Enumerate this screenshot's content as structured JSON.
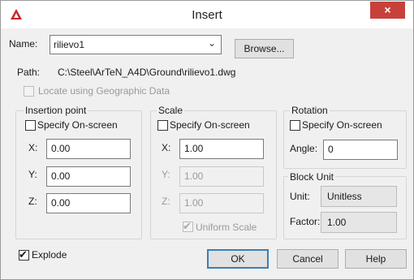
{
  "window": {
    "title": "Insert",
    "close_glyph": "×",
    "accent": "#c7413b"
  },
  "name_row": {
    "label": "Name:",
    "value": "rilievo1",
    "browse_label": "Browse..."
  },
  "path_row": {
    "label": "Path:",
    "value": "C:\\Steel\\ArTeN_A4D\\Ground\\rilievo1.dwg"
  },
  "geo": {
    "label": "Locate using Geographic Data",
    "checked": false
  },
  "insertion": {
    "title": "Insertion point",
    "specify_label": "Specify On-screen",
    "x_label": "X:",
    "x_value": "0.00",
    "y_label": "Y:",
    "y_value": "0.00",
    "z_label": "Z:",
    "z_value": "0.00"
  },
  "scale": {
    "title": "Scale",
    "specify_label": "Specify On-screen",
    "x_label": "X:",
    "x_value": "1.00",
    "y_label": "Y:",
    "y_value": "1.00",
    "z_label": "Z:",
    "z_value": "1.00",
    "uniform_label": "Uniform Scale",
    "uniform_checked": true
  },
  "rotation": {
    "title": "Rotation",
    "specify_label": "Specify On-screen",
    "angle_label": "Angle:",
    "angle_value": "0"
  },
  "block_unit": {
    "title": "Block Unit",
    "unit_label": "Unit:",
    "unit_value": "Unitless",
    "factor_label": "Factor:",
    "factor_value": "1.00"
  },
  "explode": {
    "label": "Explode",
    "checked": true
  },
  "buttons": {
    "ok": "OK",
    "cancel": "Cancel",
    "help": "Help"
  },
  "icons": {
    "app": "autocad-logo-icon",
    "dropdown": "chevron-down-icon",
    "check": "✔"
  }
}
